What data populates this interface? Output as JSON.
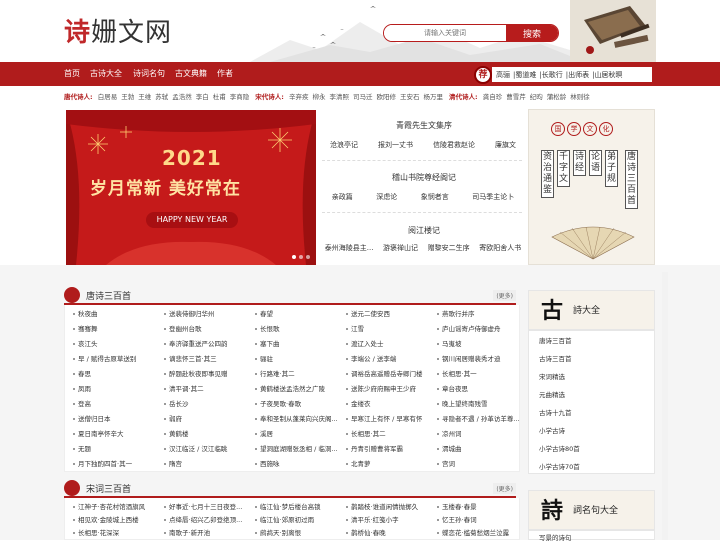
{
  "header": {
    "logo_prefix": "诗",
    "logo_rest": "姗文网",
    "search_placeholder": "请输入关键词",
    "search_button": "搜索"
  },
  "nav": {
    "items": [
      "首页",
      "古诗大全",
      "诗词名句",
      "古文典籍",
      "作者"
    ],
    "seal": "荐",
    "recommend": [
      "高骊",
      "蜀道难",
      "长歌行",
      "出师表",
      "山居秋暝"
    ]
  },
  "poets": {
    "tang_label": "唐代诗人:",
    "tang": [
      "白居易",
      "王勃",
      "王维",
      "苏轼",
      "孟浩然",
      "李白",
      "杜甫",
      "李商隐"
    ],
    "song_label": "宋代诗人:",
    "song": [
      "辛弃疾",
      "柳永",
      "李清照",
      "司马迁",
      "欧阳修",
      "王安石",
      "杨万里"
    ],
    "qing_label": "清代诗人:",
    "qing": [
      "龚自珍",
      "曹雪芹",
      "纪昀",
      "蒲松龄",
      "林则徐"
    ]
  },
  "banner": {
    "year": "2021",
    "slogan": "岁月常新  美好常在",
    "hny": "HAPPY NEW YEAR"
  },
  "center": {
    "s1_title": "青霞先生文集序",
    "s1_links": [
      "沧浪亭记",
      "报刘一丈书",
      "信陵君救赵论",
      "廉旗文"
    ],
    "s2_title": "稽山书院尊经阁记",
    "s2_links": [
      "亲政篇",
      "深虑论",
      "象悯者言",
      "司马季主论卜"
    ],
    "s3_title": "阅江楼记",
    "s3_links": [
      "泰州海陵县主...",
      "游褒禅山记",
      "赠黎安二生序",
      "寄欧阳舍人书"
    ]
  },
  "culture": {
    "title_chars": [
      "国",
      "学",
      "文",
      "化"
    ],
    "books": [
      "唐诗三百首",
      "弟子规",
      "论语",
      "诗经",
      "千字文",
      "资治通鉴"
    ]
  },
  "tang_list": {
    "title": "唐诗三百首",
    "more": "(更多)",
    "columns": [
      [
        "秋夜曲",
        "骞骞舞",
        "哀江头",
        "早 / 赋得古原草送别",
        "春思",
        "凤雨",
        "登高",
        "送僧归日本",
        "夏日南亭怀辛大",
        "无题",
        "月下独酌四首·其一"
      ],
      [
        "送裴侍御归华州",
        "登幽州台歌",
        "奉济驿重送严公四韵",
        "谪悲怀三首·其三",
        "醉题赴秋夜即事见赠",
        "清平调·其二",
        "岳长沙",
        "弱府",
        "黄鹤楼",
        "汉江临泛 / 汉江临眺",
        "隋宫"
      ],
      [
        "春望",
        "长恨歌",
        "塞下曲",
        "骊驻",
        "行路难·其二",
        "黄鹤楼送孟浩然之广陵",
        "子夜吴歌·春歌",
        "奉和圣制从蓬莱向兴庆阁...",
        "溪居",
        "望洞庭湖赠张丞相 / 临洞...",
        "西施咏"
      ],
      [
        "送元二使安西",
        "江雪",
        "渡辽入处士",
        "李端公 / 送李端",
        "调裕岳高遥赠岳寺卿门楼",
        "送陈少府府赐申王少府",
        "金缕衣",
        "早寒江上有怀 / 早寒有怀",
        "长相思·其二",
        "丹青引赠曹将军霸",
        "北青萝"
      ],
      [
        "燕歌行并序",
        "庐山谣寄卢侍御虚舟",
        "马嵬坡",
        "钢川闲居赠裴秀才迪",
        "长相思·其一",
        "章台夜思",
        "晚上望终南残雪",
        "寻隐者不遇 / 孙革访羊尊...",
        "凉州词",
        "渭城曲",
        "宫词"
      ]
    ]
  },
  "song_list": {
    "title": "宋词三百首",
    "more": "(更多)",
    "columns": [
      [
        "江神子·杏花村馆酒旗风",
        "相见欢·金陵城上西楼",
        "长相思·花深深"
      ],
      [
        "好事近·七月十三日夜登...",
        "点绛唇·绍兴乙卯登绝顶...",
        "南歌子·新开池"
      ],
      [
        "临江仙·梦后楼台高锁",
        "临江仙·郊原初过雨",
        "鹧鸪天·别离恨"
      ],
      [
        "鹊踏枝·谁道闲情抛掷久",
        "清平乐·红笺小字",
        "鹊桥仙·春晚"
      ],
      [
        "玉楼春·春景",
        "忆王孙·春词",
        "蝶恋花·槛菊愁烟兰泣露"
      ]
    ]
  },
  "right_gushi": {
    "big": "古",
    "sub": "詩大全",
    "items": [
      "唐诗三百首",
      "古诗三百首",
      "宋词精选",
      "元曲精选",
      "古诗十九首",
      "小学古诗",
      "小学古诗80首",
      "小学古诗70首"
    ]
  },
  "right_mingju": {
    "big": "詩",
    "sub": "詞名句大全",
    "items": [
      "写景的诗句"
    ]
  },
  "colors": {
    "brand_red": "#b01c1c",
    "banner_red": "#c51a1a"
  }
}
